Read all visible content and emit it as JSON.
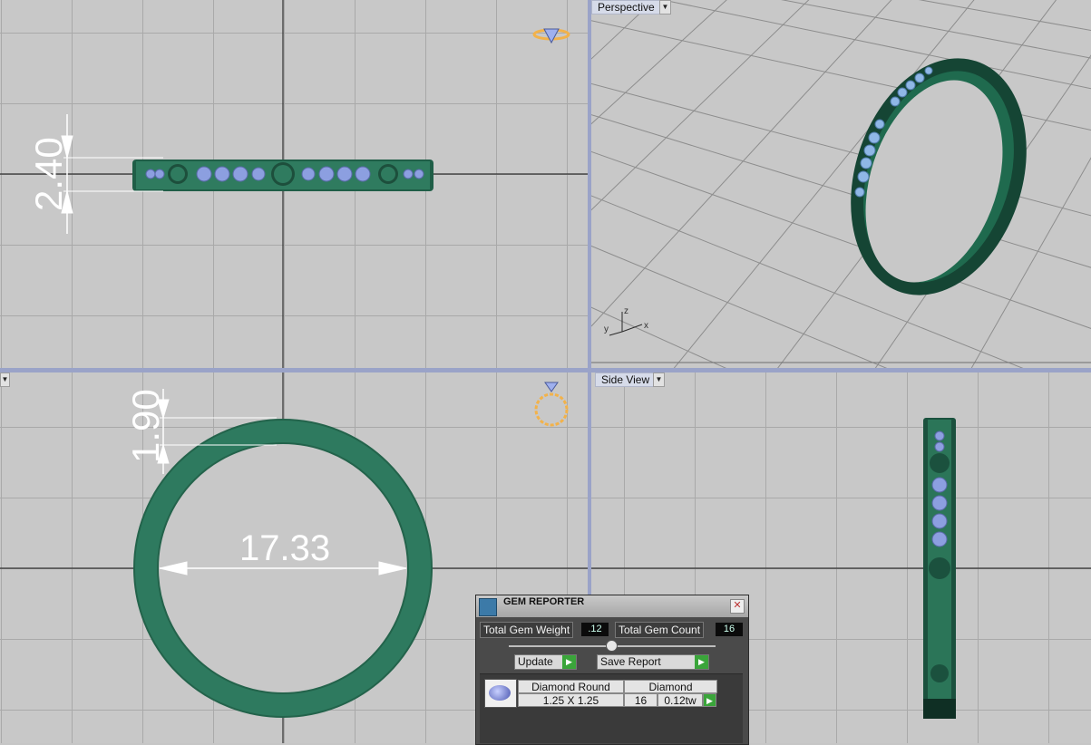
{
  "viewports": {
    "perspective_label": "Perspective",
    "side_label": "Side View"
  },
  "dimensions": {
    "top_width": "2.40",
    "front_thickness": "1.90",
    "front_diameter": "17.33"
  },
  "axes": {
    "x": "x",
    "y": "y",
    "z": "z"
  },
  "gem_reporter": {
    "title": "GEM REPORTER",
    "total_gem_weight_label": "Total Gem Weight",
    "total_gem_weight_value": ".12",
    "total_gem_count_label": "Total Gem Count",
    "total_gem_count_value": "16",
    "update_label": "Update",
    "save_report_label": "Save Report",
    "table": {
      "col1_header": "Diamond Round",
      "col2_header": "Diamond",
      "size": "1.25 X 1.25",
      "count": "16",
      "weight": "0.12tw"
    }
  },
  "colors": {
    "ring_green": "#2e7a5f",
    "gem_blue": "#8c9fe0",
    "viewport_bg": "#c8c8c8",
    "separator": "#9aa3c8"
  }
}
